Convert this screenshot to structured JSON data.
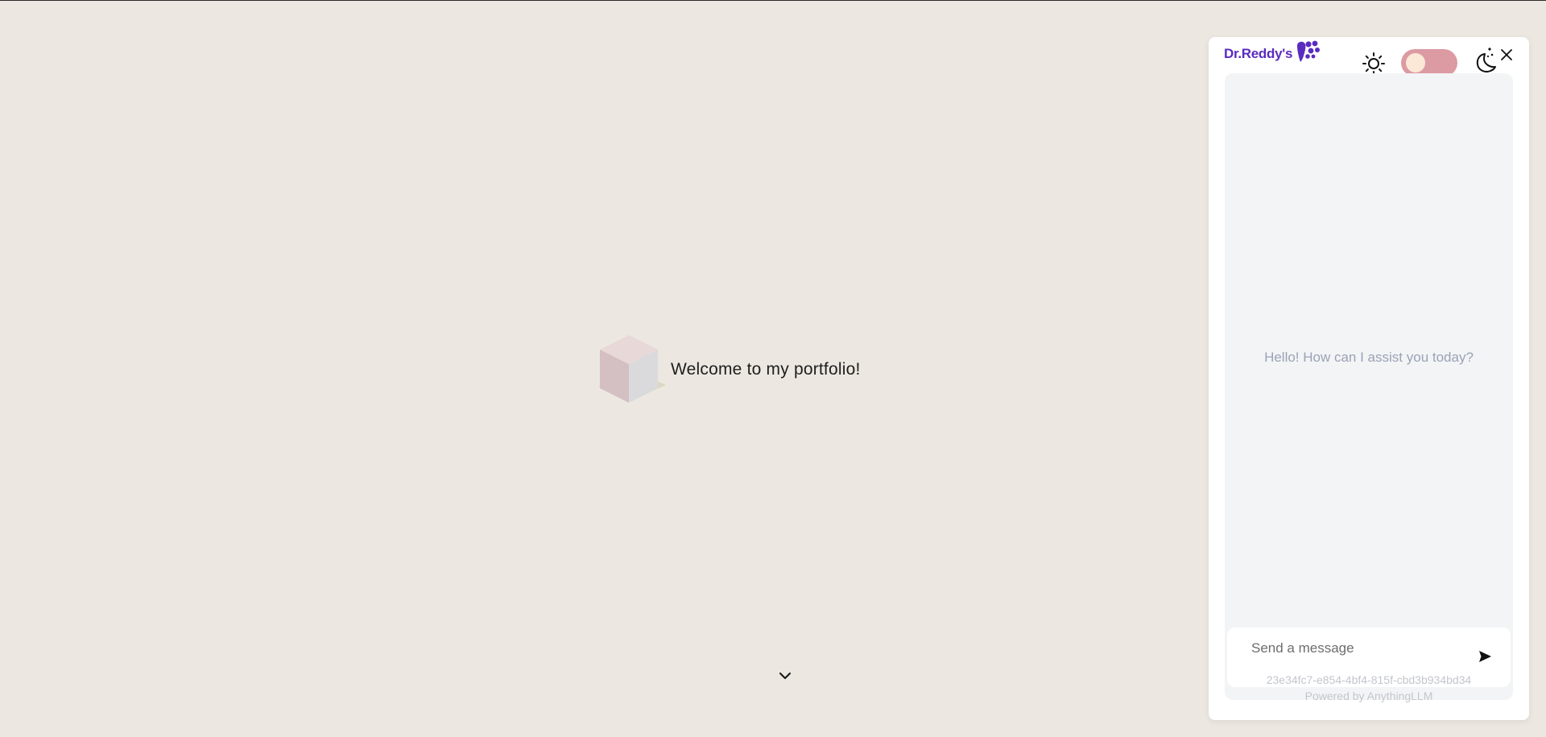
{
  "page": {
    "hero_text": "Welcome to my portfolio!",
    "background_color": "#ece8e1",
    "scroll_icon": "chevron-down-icon"
  },
  "chat": {
    "brand_text": "Dr.Reddy's",
    "brand_color": "#5a2bbf",
    "theme_toggle_on": true,
    "toggle_color": "#dc9aa2",
    "greeting": "Hello! How can I assist you today?",
    "input_placeholder": "Send a message",
    "input_value": "",
    "session_id": "23e34fc7-e854-4bf4-815f-cbd3b934bd34",
    "powered_by": "Powered by AnythingLLM",
    "icons": [
      "sun-icon",
      "moon-icon",
      "close-icon",
      "send-icon",
      "heart-logo-icon"
    ]
  }
}
